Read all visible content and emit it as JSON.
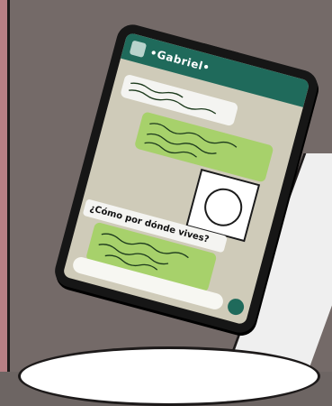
{
  "chat": {
    "contact_name": "•Gabriel•",
    "message_text": "¿Cómo por dónde vives?"
  },
  "colors": {
    "header": "#1f6a5b",
    "bubble_green": "#a7d16b",
    "bubble_white": "#f4f4f1",
    "screen_bg": "#cfcbb9"
  },
  "icons": [
    "avatar",
    "mic-icon",
    "emoji-icon",
    "camera-icon"
  ]
}
